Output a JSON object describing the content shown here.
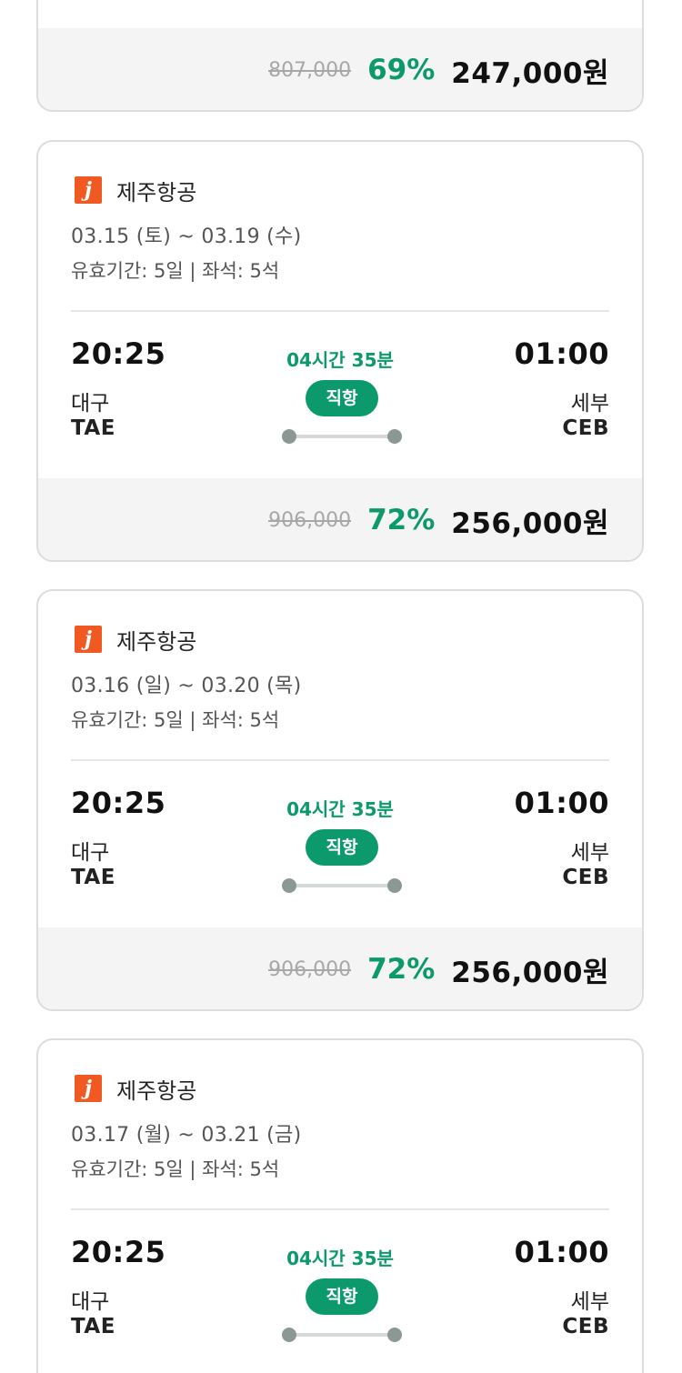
{
  "cards": [
    {
      "price": {
        "original": "807,000",
        "discount": "69%",
        "final": "247,000원"
      }
    },
    {
      "airline": "제주항공",
      "logo_letter": "j",
      "dates": "03.15 (토) ~ 03.19 (수)",
      "validity": "유효기간: 5일 | 좌석: 5석",
      "departure": {
        "time": "20:25",
        "city": "대구",
        "code": "TAE"
      },
      "arrival": {
        "time": "01:00",
        "city": "세부",
        "code": "CEB"
      },
      "duration": "04시간 35분",
      "stop_type": "직항",
      "price": {
        "original": "906,000",
        "discount": "72%",
        "final": "256,000원"
      }
    },
    {
      "airline": "제주항공",
      "logo_letter": "j",
      "dates": "03.16 (일) ~ 03.20 (목)",
      "validity": "유효기간: 5일 | 좌석: 5석",
      "departure": {
        "time": "20:25",
        "city": "대구",
        "code": "TAE"
      },
      "arrival": {
        "time": "01:00",
        "city": "세부",
        "code": "CEB"
      },
      "duration": "04시간 35분",
      "stop_type": "직항",
      "price": {
        "original": "906,000",
        "discount": "72%",
        "final": "256,000원"
      }
    },
    {
      "airline": "제주항공",
      "logo_letter": "j",
      "dates": "03.17 (월) ~ 03.21 (금)",
      "validity": "유효기간: 5일 | 좌석: 5석",
      "departure": {
        "time": "20:25",
        "city": "대구",
        "code": "TAE"
      },
      "arrival": {
        "time": "01:00",
        "city": "세부",
        "code": "CEB"
      },
      "duration": "04시간 35분",
      "stop_type": "직항"
    }
  ],
  "colors": {
    "accent_green": "#0c9a6c",
    "airline_logo": "#f05a22",
    "price_bar_bg": "#f4f4f4",
    "card_border": "#dcdcdc"
  },
  "icons": {
    "airline_logo": "jeju-air-logo-icon",
    "route_dot": "route-dot-icon"
  }
}
